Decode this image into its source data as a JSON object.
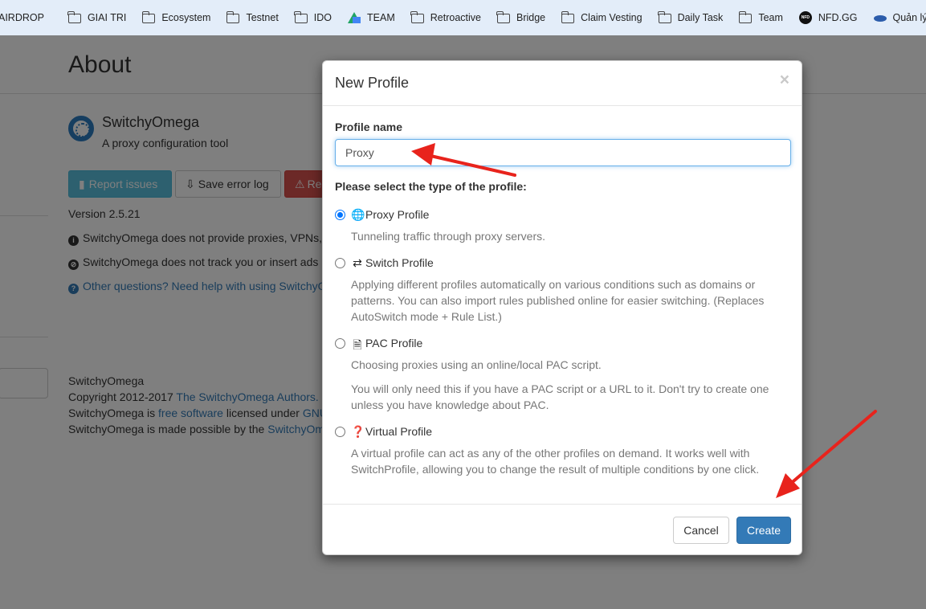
{
  "bookmarks": [
    {
      "label": "AIRDROP",
      "icon": "none"
    },
    {
      "label": "GIAI TRI",
      "icon": "folder-icon"
    },
    {
      "label": "Ecosystem",
      "icon": "folder-icon"
    },
    {
      "label": "Testnet",
      "icon": "folder-icon"
    },
    {
      "label": "IDO",
      "icon": "folder-icon"
    },
    {
      "label": "TEAM",
      "icon": "google-drive-icon"
    },
    {
      "label": "Retroactive",
      "icon": "folder-icon"
    },
    {
      "label": "Bridge",
      "icon": "folder-icon"
    },
    {
      "label": "Claim Vesting",
      "icon": "folder-icon"
    },
    {
      "label": "Daily Task",
      "icon": "folder-icon"
    },
    {
      "label": "Team",
      "icon": "folder-icon"
    },
    {
      "label": "NFD.GG",
      "icon": "nfd-icon"
    },
    {
      "label": "Quản lý dịch vụ (",
      "icon": "service-icon"
    }
  ],
  "page": {
    "title": "About",
    "app_name": "SwitchyOmega",
    "app_desc": "A proxy configuration tool",
    "buttons": {
      "report": "Report issues",
      "save_log": "Save error log",
      "reset": "Re"
    },
    "version": "Version 2.5.21",
    "notes": [
      "SwitchyOmega does not provide proxies, VPNs,",
      "SwitchyOmega does not track you or insert ads",
      "Other questions? Need help with using SwitchyO"
    ],
    "footer": {
      "line1": "SwitchyOmega",
      "line2_prefix": "Copyright 2012-2017 ",
      "line2_link": "The SwitchyOmega Authors.",
      "line3_prefix": "SwitchyOmega is ",
      "line3_link": "free software",
      "line3_mid": " licensed under ",
      "line3_link2": "GNU",
      "line4_prefix": "SwitchyOmega is made possible by the ",
      "line4_link": "SwitchyOm"
    }
  },
  "modal": {
    "title": "New Profile",
    "close": "×",
    "profile_name_label": "Profile name",
    "profile_name_value": "Proxy",
    "type_label": "Please select the type of the profile:",
    "options": [
      {
        "title": "Proxy Profile",
        "icon": "globe-icon",
        "checked": true,
        "desc": [
          "Tunneling traffic through proxy servers."
        ]
      },
      {
        "title": "Switch Profile",
        "icon": "retweet-icon",
        "checked": false,
        "desc": [
          "Applying different profiles automatically on various conditions such as domains or patterns. You can also import rules published online for easier switching. (Replaces AutoSwitch mode + Rule List.)"
        ]
      },
      {
        "title": "PAC Profile",
        "icon": "file-icon",
        "checked": false,
        "desc": [
          "Choosing proxies using an online/local PAC script.",
          "You will only need this if you have a PAC script or a URL to it. Don't try to create one unless you have knowledge about PAC."
        ]
      },
      {
        "title": "Virtual Profile",
        "icon": "question-sign-icon",
        "checked": false,
        "desc": [
          "A virtual profile can act as any of the other profiles on demand. It works well with SwitchProfile, allowing you to change the result of multiple conditions by one click."
        ]
      }
    ],
    "cancel": "Cancel",
    "create": "Create"
  },
  "colors": {
    "primary": "#337ab7",
    "info": "#5bc0de",
    "danger": "#d9534f",
    "annotation_arrow": "#e8231c"
  }
}
